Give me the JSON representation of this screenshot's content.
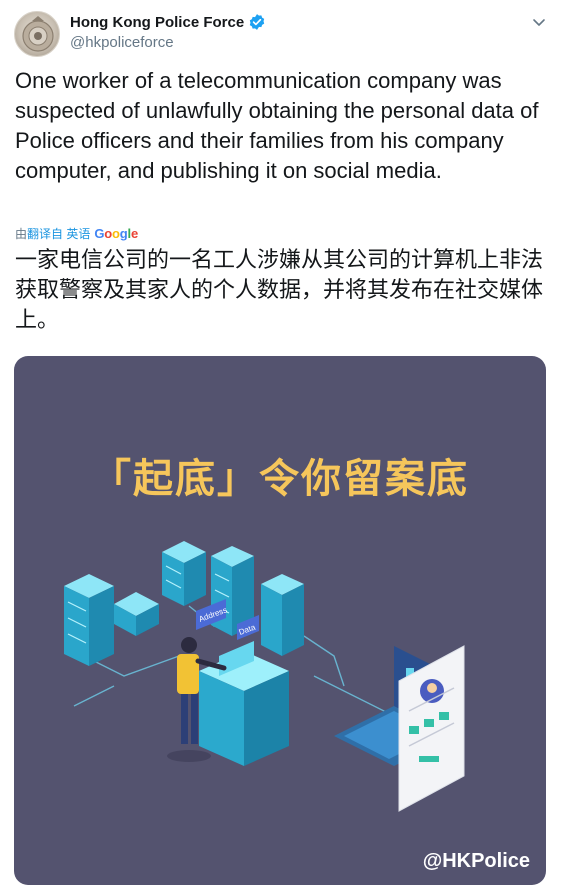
{
  "tweet": {
    "author": {
      "display_name": "Hong Kong Police Force",
      "handle": "@hkpoliceforce"
    },
    "text": "One worker of a telecommunication company was suspected of unlawfully obtaining the personal data of Police officers and their families from his company computer, and publishing it on social media.",
    "translation": {
      "by_label": "由",
      "link_label": "翻译自 英语",
      "provider": "Google",
      "text": "一家电信公司的一名工人涉嫌从其公司的计算机上非法获取警察及其家人的个人数据，并将其发布在社交媒体上。"
    },
    "media": {
      "headline": "「起底」令你留案底",
      "watermark": "@HKPolice",
      "labels": {
        "address": "Address",
        "data": "Data"
      }
    }
  },
  "colors": {
    "accent": "#1b95e0",
    "poster_bg": "#54536f",
    "poster_headline": "#f6c65b",
    "server_blue": "#38c6e8"
  },
  "icons": [
    "police-badge-avatar",
    "verified-badge-icon",
    "chevron-down-icon"
  ]
}
